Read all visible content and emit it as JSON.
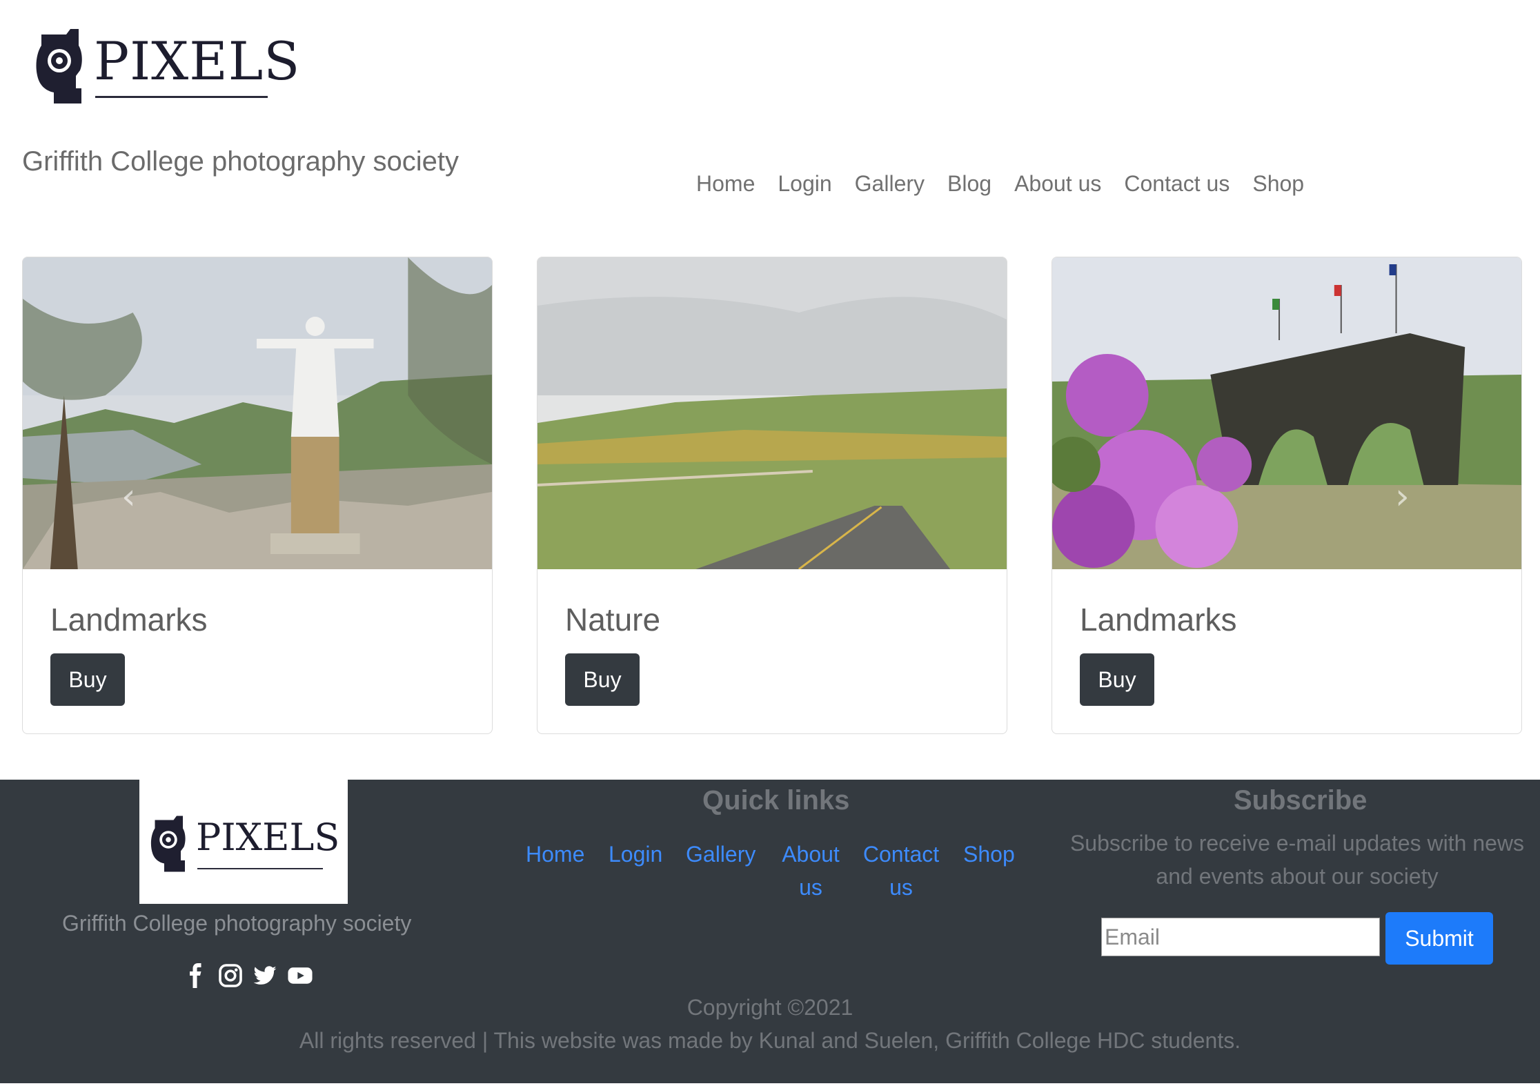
{
  "header": {
    "logo_text": "PIXELS",
    "tagline": "Griffith College photography society",
    "nav": [
      "Home",
      "Login",
      "Gallery",
      "Blog",
      "About us",
      "Contact us",
      "Shop"
    ]
  },
  "cards": [
    {
      "title": "Landmarks",
      "button": "Buy"
    },
    {
      "title": "Nature",
      "button": "Buy"
    },
    {
      "title": "Landmarks",
      "button": "Buy"
    }
  ],
  "carousel": {
    "prev_icon": "chevron-left-icon",
    "next_icon": "chevron-right-icon"
  },
  "footer": {
    "logo_text": "PIXELS",
    "tagline": "Griffith College photography society",
    "social_icons": [
      "facebook-icon",
      "instagram-icon",
      "twitter-icon",
      "youtube-icon"
    ],
    "quick_links_title": "Quick links",
    "quick_links": [
      "Home",
      "Login",
      "Gallery",
      "About us",
      "Contact us",
      "Shop"
    ],
    "subscribe_title": "Subscribe",
    "subscribe_text": "Subscribe to receive e-mail updates with news and events about our society",
    "email_placeholder": "Email",
    "submit_label": "Submit",
    "copyright": "Copyright ©2021",
    "rights": "All rights reserved | This website was made by Kunal and Suelen, Griffith College HDC students."
  },
  "colors": {
    "button_dark": "#343a40",
    "footer_bg": "#343a40",
    "link_blue": "#3d8bfd",
    "submit_blue": "#1d7bfa"
  }
}
